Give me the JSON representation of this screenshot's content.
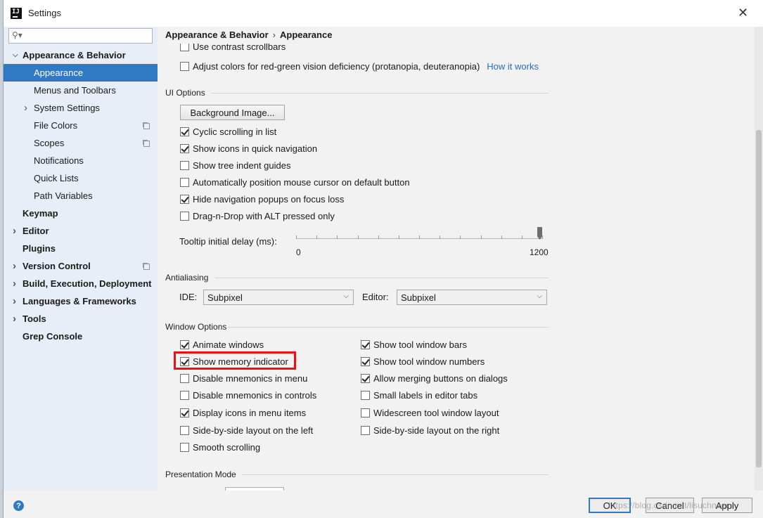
{
  "window": {
    "title": "Settings",
    "app_icon_text": "IJ",
    "close_symbol": "✕"
  },
  "sidebar": {
    "search_placeholder": "",
    "items": [
      {
        "label": "Appearance & Behavior",
        "bold": true,
        "expanded": true
      },
      {
        "label": "Appearance",
        "selected": true
      },
      {
        "label": "Menus and Toolbars"
      },
      {
        "label": "System Settings",
        "expandable": true
      },
      {
        "label": "File Colors",
        "copy_icon": true
      },
      {
        "label": "Scopes",
        "copy_icon": true
      },
      {
        "label": "Notifications"
      },
      {
        "label": "Quick Lists"
      },
      {
        "label": "Path Variables"
      },
      {
        "label": "Keymap",
        "bold": true
      },
      {
        "label": "Editor",
        "bold": true,
        "expandable": true
      },
      {
        "label": "Plugins",
        "bold": true
      },
      {
        "label": "Version Control",
        "bold": true,
        "expandable": true,
        "copy_icon": true
      },
      {
        "label": "Build, Execution, Deployment",
        "bold": true,
        "expandable": true
      },
      {
        "label": "Languages & Frameworks",
        "bold": true,
        "expandable": true
      },
      {
        "label": "Tools",
        "bold": true,
        "expandable": true
      },
      {
        "label": "Grep Console",
        "bold": true
      }
    ]
  },
  "breadcrumb": {
    "parent": "Appearance & Behavior",
    "separator": "›",
    "current": "Appearance"
  },
  "top_options": {
    "contrast_scrollbars": {
      "label": "Use contrast scrollbars",
      "checked": false
    },
    "color_deficiency": {
      "label": "Adjust colors for red-green vision deficiency (protanopia, deuteranopia)",
      "checked": false,
      "link": "How it works"
    }
  },
  "ui_options": {
    "title": "UI Options",
    "background_image_button": "Background Image...",
    "checkboxes": [
      {
        "label": "Cyclic scrolling in list",
        "checked": true
      },
      {
        "label": "Show icons in quick navigation",
        "checked": true
      },
      {
        "label": "Show tree indent guides",
        "checked": false
      },
      {
        "label": "Automatically position mouse cursor on default button",
        "checked": false
      },
      {
        "label": "Hide navigation popups on focus loss",
        "checked": true
      },
      {
        "label": "Drag-n-Drop with ALT pressed only",
        "checked": false
      }
    ],
    "tooltip_delay": {
      "label": "Tooltip initial delay (ms):",
      "min": "0",
      "max": "1200",
      "value": 1200
    }
  },
  "antialiasing": {
    "title": "Antialiasing",
    "ide_label": "IDE:",
    "ide_value": "Subpixel",
    "editor_label": "Editor:",
    "editor_value": "Subpixel"
  },
  "window_options": {
    "title": "Window Options",
    "left": [
      {
        "label": "Animate windows",
        "checked": true
      },
      {
        "label": "Show memory indicator",
        "checked": true,
        "highlighted": true
      },
      {
        "label": "Disable mnemonics in menu",
        "checked": false
      },
      {
        "label": "Disable mnemonics in controls",
        "checked": false
      },
      {
        "label": "Display icons in menu items",
        "checked": true
      },
      {
        "label": "Side-by-side layout on the left",
        "checked": false
      },
      {
        "label": "Smooth scrolling",
        "checked": false
      }
    ],
    "right": [
      {
        "label": "Show tool window bars",
        "checked": true
      },
      {
        "label": "Show tool window numbers",
        "checked": true
      },
      {
        "label": "Allow merging buttons on dialogs",
        "checked": true
      },
      {
        "label": "Small labels in editor tabs",
        "checked": false
      },
      {
        "label": "Widescreen tool window layout",
        "checked": false
      },
      {
        "label": "Side-by-side layout on the right",
        "checked": false
      }
    ]
  },
  "presentation_mode": {
    "title": "Presentation Mode"
  },
  "footer": {
    "help": "?",
    "ok": "OK",
    "cancel": "Cancel",
    "apply": "Apply",
    "watermark": "https://blog.csdn.net/lisuchneer"
  },
  "colors": {
    "accent": "#2f7ac2",
    "highlight_border": "#ee1010",
    "link": "#2a6ebb"
  }
}
